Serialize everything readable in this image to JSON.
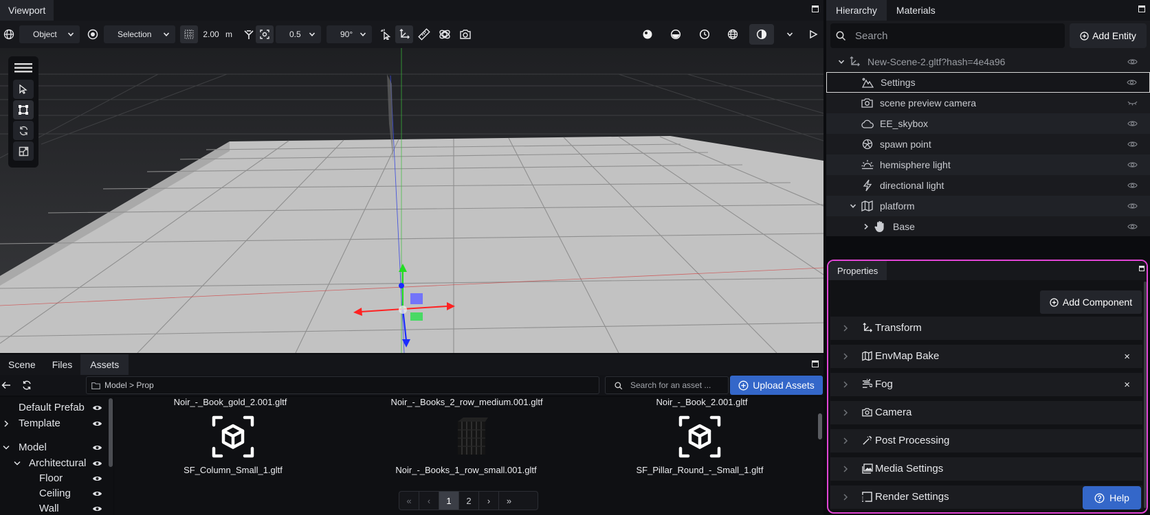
{
  "viewport": {
    "tab": "Viewport",
    "toolbar": {
      "transform_space": "Object",
      "pivot_mode": "Selection",
      "grid_snap": "2.00",
      "grid_unit": "m",
      "translation_snap": "0.5",
      "rotation_snap": "90°"
    }
  },
  "hierarchy": {
    "tabs": [
      "Hierarchy",
      "Materials"
    ],
    "search_placeholder": "Search",
    "add_entity_label": "Add Entity",
    "items": [
      {
        "label": "New-Scene-2.gltf?hash=4e4a96",
        "icon": "transform-icon",
        "visible": true
      },
      {
        "label": "Settings",
        "icon": "mountain-icon",
        "visible": true
      },
      {
        "label": "scene preview camera",
        "icon": "camera-icon",
        "visible": false
      },
      {
        "label": "EE_skybox",
        "icon": "cloud-icon",
        "visible": true
      },
      {
        "label": "spawn point",
        "icon": "aperture-icon",
        "visible": true
      },
      {
        "label": "hemisphere light",
        "icon": "sunrise-icon",
        "visible": true
      },
      {
        "label": "directional light",
        "icon": "bolt-icon",
        "visible": true
      },
      {
        "label": "platform",
        "icon": "map-icon",
        "visible": true
      },
      {
        "label": "Base",
        "icon": "hand-icon",
        "visible": true
      }
    ]
  },
  "properties": {
    "tab": "Properties",
    "add_component_label": "Add Component",
    "components": [
      {
        "label": "Transform",
        "icon": "transform-icon",
        "removable": false
      },
      {
        "label": "EnvMap Bake",
        "icon": "map-icon",
        "removable": true
      },
      {
        "label": "Fog",
        "icon": "fog-icon",
        "removable": true
      },
      {
        "label": "Camera",
        "icon": "camera-icon",
        "removable": false
      },
      {
        "label": "Post Processing",
        "icon": "wand-icon",
        "removable": false
      },
      {
        "label": "Media Settings",
        "icon": "media-icon",
        "removable": false
      },
      {
        "label": "Render Settings",
        "icon": "render-icon",
        "removable": false
      }
    ],
    "remove_symbol": "×",
    "help_label": "Help"
  },
  "bottom": {
    "tabs": [
      "Scene",
      "Files",
      "Assets"
    ],
    "breadcrumb": "Model > Prop",
    "asset_search_placeholder": "Search for an asset ...",
    "upload_label": "Upload Assets",
    "tree": [
      {
        "label": "Default Prefab"
      },
      {
        "label": "Template"
      },
      {
        "label": "Model"
      },
      {
        "label": "Architectural"
      },
      {
        "label": "Floor"
      },
      {
        "label": "Ceiling"
      },
      {
        "label": "Wall"
      }
    ],
    "assets_top": [
      "Noir_-_Book_gold_2.001.gltf",
      "Noir_-_Books_2_row_medium.001.gltf",
      "Noir_-_Book_2.001.gltf"
    ],
    "assets": [
      "SF_Column_Small_1.gltf",
      "Noir_-_Books_1_row_small.001.gltf",
      "SF_Pillar_Round_-_Small_1.gltf"
    ],
    "pagination": {
      "first": "«",
      "prev": "‹",
      "pages": [
        "1",
        "2"
      ],
      "current": "1",
      "next": "›",
      "last": "»"
    }
  },
  "colors": {
    "accent_blue": "#3467c9",
    "highlight_magenta": "#e245d6",
    "panel_bg": "#1a1b1f"
  }
}
